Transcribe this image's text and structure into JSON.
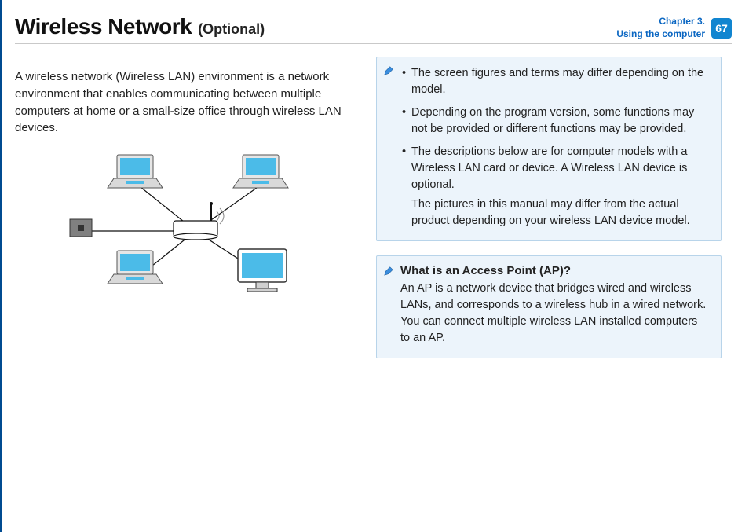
{
  "header": {
    "title": "Wireless Network",
    "subtitle": "(Optional)",
    "chapter_line1": "Chapter 3.",
    "chapter_line2": "Using the computer",
    "page_number": "67"
  },
  "intro": "A wireless network (Wireless LAN) environment is a network environment that enables communicating between multiple computers at home or a small-size office through wireless LAN devices.",
  "notes": {
    "items": [
      "The screen figures and terms may differ depending on the model.",
      "Depending on the program version, some functions may not be provided or different functions may be provided.",
      "The descriptions below are for computer models with a Wireless LAN card or device. A Wireless LAN device is optional."
    ],
    "item3_extra": "The pictures in this manual may differ from the actual product depending on your wireless LAN device model."
  },
  "ap_box": {
    "title": "What is an Access Point (AP)?",
    "text": "An AP is a network device that bridges wired and wireless LANs, and corresponds to a wireless hub in a wired network. You can connect multiple wireless LAN installed computers to an AP."
  }
}
